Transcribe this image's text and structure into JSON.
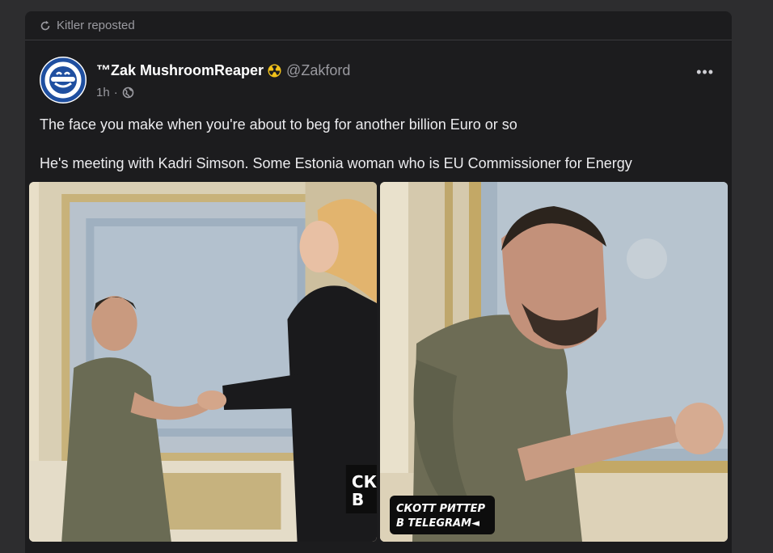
{
  "repost": {
    "label": "Kitler reposted",
    "icon": "repost-icon"
  },
  "post": {
    "author": {
      "name": "™Zak MushroomReaper",
      "badge": "radiation-icon",
      "handle": "@Zakford"
    },
    "time": "1h",
    "visibility_icon": "globe-icon",
    "more_icon": "more-dots-icon",
    "more_label": "•••",
    "paragraphs": [
      "The face you make when you're about to beg for another billion Euro or so",
      "He's meeting with Kadri Simson. Some Estonia woman who is EU Commissioner for Energy"
    ]
  },
  "images": [
    {
      "watermark": "СК\nВ",
      "watermark_line1": "СК",
      "watermark_line2": "В"
    },
    {
      "watermark_line1": "СКОТТ РИТТЕР",
      "watermark_line2": "В TELEGRAM◄"
    }
  ],
  "colors": {
    "background": "#2d2d2f",
    "card": "#1c1c1e",
    "muted_text": "#9a9aa0",
    "badge_yellow": "#f2c21a"
  }
}
